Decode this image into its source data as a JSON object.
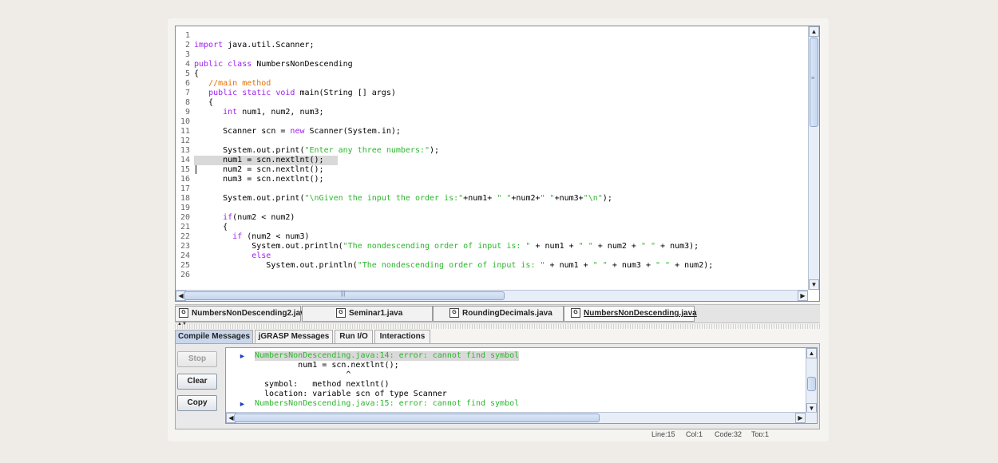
{
  "editor": {
    "line_numbers": [
      "1",
      "2",
      "3",
      "4",
      "5",
      "6",
      "7",
      "8",
      "9",
      "10",
      "11",
      "12",
      "13",
      "14",
      "15",
      "16",
      "17",
      "18",
      "19",
      "20",
      "21",
      "22",
      "23",
      "24",
      "25",
      "26"
    ],
    "lines": [
      [],
      [
        {
          "t": "import",
          "c": "kw"
        },
        {
          "t": " java.util.Scanner;",
          "c": ""
        }
      ],
      [],
      [
        {
          "t": "public class",
          "c": "kw"
        },
        {
          "t": " NumbersNonDescending",
          "c": ""
        }
      ],
      [
        {
          "t": "{",
          "c": ""
        }
      ],
      [
        {
          "t": "   ",
          "c": ""
        },
        {
          "t": "//main method",
          "c": "cm"
        }
      ],
      [
        {
          "t": "   ",
          "c": ""
        },
        {
          "t": "public static void",
          "c": "kw"
        },
        {
          "t": " main(String [] args)",
          "c": ""
        }
      ],
      [
        {
          "t": "   {",
          "c": ""
        }
      ],
      [
        {
          "t": "      ",
          "c": ""
        },
        {
          "t": "int",
          "c": "kw"
        },
        {
          "t": " num1, num2, num3;",
          "c": ""
        }
      ],
      [],
      [
        {
          "t": "      Scanner scn = ",
          "c": ""
        },
        {
          "t": "new",
          "c": "kw"
        },
        {
          "t": " Scanner(System.in);",
          "c": ""
        }
      ],
      [],
      [
        {
          "t": "      System.out.print(",
          "c": ""
        },
        {
          "t": "\"Enter any three numbers:\"",
          "c": "st"
        },
        {
          "t": ");",
          "c": ""
        }
      ],
      [
        {
          "t": "      num1 = scn.nextlnt();",
          "c": ""
        }
      ],
      [
        {
          "t": "      num2 = scn.nextlnt();",
          "c": ""
        }
      ],
      [
        {
          "t": "      num3 = scn.nextlnt();",
          "c": ""
        }
      ],
      [],
      [
        {
          "t": "      System.out.print(",
          "c": ""
        },
        {
          "t": "\"\\nGiven the input the order is:\"",
          "c": "st"
        },
        {
          "t": "+num1+ ",
          "c": ""
        },
        {
          "t": "\" \"",
          "c": "st"
        },
        {
          "t": "+num2+",
          "c": ""
        },
        {
          "t": "\" \"",
          "c": "st"
        },
        {
          "t": "+num3+",
          "c": ""
        },
        {
          "t": "\"\\n\"",
          "c": "st"
        },
        {
          "t": ");",
          "c": ""
        }
      ],
      [],
      [
        {
          "t": "      ",
          "c": ""
        },
        {
          "t": "if",
          "c": "kw"
        },
        {
          "t": "(num2 < num2)",
          "c": ""
        }
      ],
      [
        {
          "t": "      {",
          "c": ""
        }
      ],
      [
        {
          "t": "        ",
          "c": ""
        },
        {
          "t": "if",
          "c": "kw"
        },
        {
          "t": " (num2 < num3)",
          "c": ""
        }
      ],
      [
        {
          "t": "            System.out.println(",
          "c": ""
        },
        {
          "t": "\"The nondescending order of input is: \"",
          "c": "st"
        },
        {
          "t": " + num1 + ",
          "c": ""
        },
        {
          "t": "\" \"",
          "c": "st"
        },
        {
          "t": " + num2 + ",
          "c": ""
        },
        {
          "t": "\" \"",
          "c": "st"
        },
        {
          "t": " + num3);",
          "c": ""
        }
      ],
      [
        {
          "t": "            ",
          "c": ""
        },
        {
          "t": "else",
          "c": "kw"
        }
      ],
      [
        {
          "t": "               System.out.println(",
          "c": ""
        },
        {
          "t": "\"The nondescending order of input is: \"",
          "c": "st"
        },
        {
          "t": " + num1 + ",
          "c": ""
        },
        {
          "t": "\" \"",
          "c": "st"
        },
        {
          "t": " + num3 + ",
          "c": ""
        },
        {
          "t": "\" \"",
          "c": "st"
        },
        {
          "t": " + num2);",
          "c": ""
        }
      ],
      []
    ]
  },
  "file_tabs": [
    {
      "label": "NumbersNonDescending2.java",
      "icon": "G"
    },
    {
      "label": "Seminar1.java",
      "icon": "G"
    },
    {
      "label": "RoundingDecimals.java",
      "icon": "G"
    },
    {
      "label": "NumbersNonDescending.java",
      "icon": "G",
      "active": true
    }
  ],
  "panel_tabs": [
    "Compile Messages",
    "jGRASP Messages",
    "Run I/O",
    "Interactions"
  ],
  "buttons": {
    "stop": "Stop",
    "clear": "Clear",
    "copy": "Copy"
  },
  "messages": [
    {
      "text": "NumbersNonDescending.java:14: error: cannot find symbol",
      "type": "err",
      "marker": "►",
      "bg": true
    },
    {
      "text": "         num1 = scn.nextlnt();",
      "type": "plain"
    },
    {
      "text": "                   ^",
      "type": "plain"
    },
    {
      "text": "  symbol:   method nextlnt()",
      "type": "plain"
    },
    {
      "text": "  location: variable scn of type Scanner",
      "type": "plain"
    },
    {
      "text": "NumbersNonDescending.java:15: error: cannot find symbol",
      "type": "err",
      "marker": "►"
    }
  ],
  "status": {
    "line": "Line:15",
    "col": "Col:1",
    "code": "Code:32",
    "top": "Top:1"
  },
  "colors": {
    "keyword": "#a020f0",
    "comment": "#e07000",
    "string": "#2db52d",
    "active_panel_tab": "#c9d7ec"
  }
}
